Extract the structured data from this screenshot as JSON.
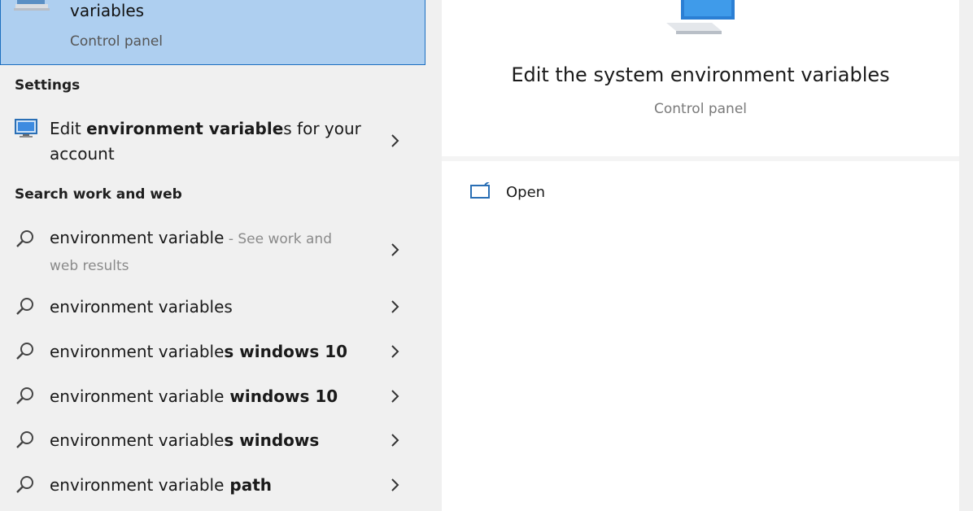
{
  "best_match": {
    "title": "variables",
    "subtitle": "Control panel",
    "icon": "system-properties-icon"
  },
  "settings": {
    "header": "Settings",
    "item": {
      "prefix": "Edit ",
      "bold": "environment variable",
      "suffix": "s for your",
      "line2": "account",
      "icon": "monitor-icon"
    }
  },
  "search_web": {
    "header": "Search work and web",
    "first": {
      "text": "environment variable",
      "hint": " - See work and",
      "hint_line2": "web results"
    },
    "suggestions": [
      {
        "plain": "environment variable",
        "bold": "s"
      },
      {
        "plain": "environment variable",
        "bold": "s windows 10"
      },
      {
        "plain": "environment variable",
        "bold": " windows 10"
      },
      {
        "plain": "environment variable",
        "bold": "s windows"
      },
      {
        "plain": "environment variable",
        "bold": " path"
      }
    ]
  },
  "detail": {
    "title": "Edit the system environment variables",
    "subtitle": "Control panel",
    "actions": [
      {
        "label": "Open",
        "icon": "open-window-icon"
      }
    ]
  },
  "colors": {
    "selection_bg": "#aecff0",
    "selection_border": "#1d6fc0",
    "pane_bg": "#f0f0f0",
    "detail_bg": "#ffffff"
  }
}
